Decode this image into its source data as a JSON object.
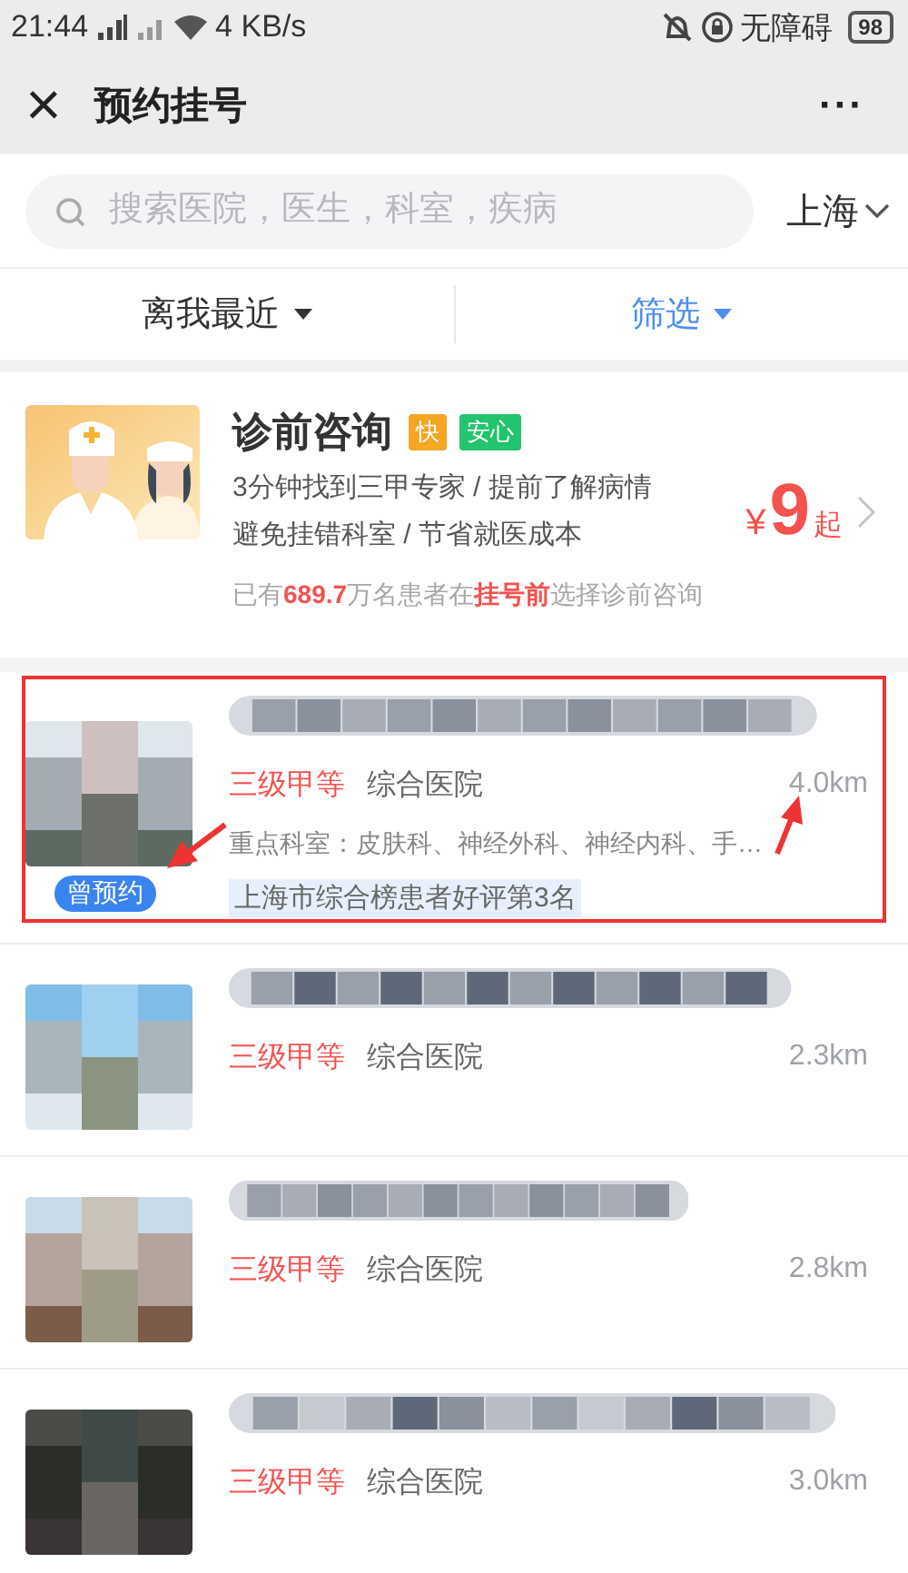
{
  "status_bar": {
    "time": "21:44",
    "speed": "4 KB/s",
    "accessibility": "无障碍",
    "battery": "98"
  },
  "title_bar": {
    "close": "×",
    "title": "预约挂号",
    "more": "···"
  },
  "search": {
    "placeholder": "搜索医院，医生，科室，疾病",
    "city": "上海"
  },
  "filters": [
    {
      "label": "离我最近",
      "selected": false
    },
    {
      "label": "筛选",
      "selected": true
    }
  ],
  "consult": {
    "title": "诊前咨询",
    "tags": [
      {
        "label": "快",
        "color": "#f5a623"
      },
      {
        "label": "安心",
        "color": "#22c46e"
      }
    ],
    "lines": [
      "3分钟找到三甲专家 / 提前了解病情",
      "避免挂错科室 / 节省就医成本"
    ],
    "stats": "已有**689.7**万名患者在**挂号前**选择诊前咨询",
    "currency": "¥",
    "price": "9",
    "price_suffix": "起"
  },
  "hospitals": [
    {
      "level": "三级甲等",
      "type": "综合医院",
      "distance": "4.0km",
      "departments": "重点科室：皮肤科、神经外科、神经内科、手…",
      "ranking": "上海市综合榜患者好评第3名",
      "badge": "曾预约",
      "highlighted": true
    },
    {
      "level": "三级甲等",
      "type": "综合医院",
      "distance": "2.3km",
      "highlighted": false
    },
    {
      "level": "三级甲等",
      "type": "综合医院",
      "distance": "2.8km",
      "highlighted": false
    },
    {
      "level": "三级甲等",
      "type": "综合医院",
      "distance": "3.0km",
      "highlighted": false
    }
  ]
}
